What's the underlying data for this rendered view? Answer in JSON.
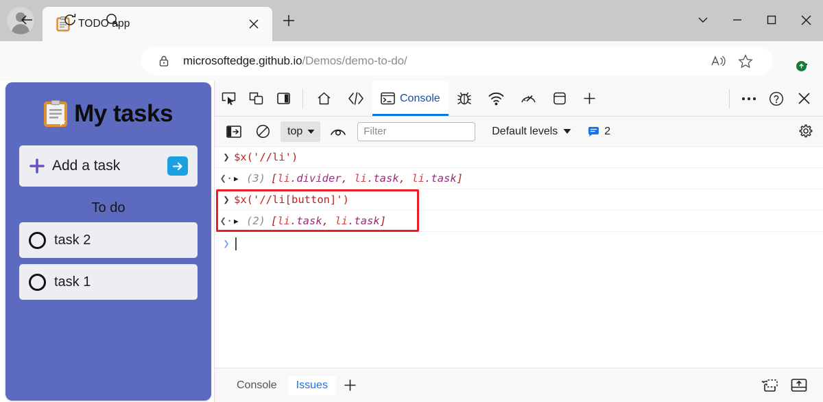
{
  "browser": {
    "tab": {
      "title": "TODO app",
      "favicon": "clipboard-icon",
      "close": "✕"
    },
    "new_tab_label": "+",
    "window_controls": {
      "more": "⌄",
      "minimize": "—",
      "maximize": "▢",
      "close": "✕"
    },
    "nav": {
      "back": "←",
      "reload": "⟳",
      "search": "⌕"
    },
    "address": {
      "lock": "lock-icon",
      "domain": "microsoftedge.github.io",
      "path": "/Demos/demo-to-do/"
    },
    "address_actions": {
      "read_aloud": "A",
      "favorite": "☆"
    },
    "settings_more": "…"
  },
  "todo": {
    "title": "My tasks",
    "favicon": "clipboard-icon",
    "add_task": {
      "plus": "✚",
      "label": "Add a task",
      "submit": "➜"
    },
    "section_label": "To do",
    "tasks": [
      {
        "label": "task 2",
        "done": false
      },
      {
        "label": "task 1",
        "done": false
      }
    ]
  },
  "devtools": {
    "toolbar_left_icons": [
      "inspect-element-icon",
      "device-emulation-icon",
      "toggle-sidebar-icon"
    ],
    "tabs": [
      {
        "label": "",
        "icon": "home-icon",
        "active": false
      },
      {
        "label": "",
        "icon": "elements-icon",
        "active": false
      },
      {
        "label": "Console",
        "icon": "console-icon",
        "active": true
      },
      {
        "label": "",
        "icon": "debugger-icon",
        "active": false
      },
      {
        "label": "",
        "icon": "network-icon",
        "active": false
      },
      {
        "label": "",
        "icon": "performance-icon",
        "active": false
      },
      {
        "label": "",
        "icon": "application-icon",
        "active": false
      },
      {
        "label": "",
        "icon": "add-tool-icon",
        "active": false
      }
    ],
    "toolbar_right": {
      "more": "…",
      "help": "?",
      "close": "✕"
    },
    "filterbar": {
      "sidebar_toggle": "console-sidebar-icon",
      "clear": "clear-console-icon",
      "context": "top",
      "context_caret": "▼",
      "eye": "live-expression-icon",
      "filter_placeholder": "Filter",
      "filter_value": "",
      "levels_label": "Default levels",
      "levels_caret": "▼",
      "message_count": "2",
      "message_icon": "info-bubble-icon",
      "settings": "gear-icon"
    },
    "console": {
      "entries": [
        {
          "type": "input",
          "gutter": "❯",
          "code": "$x('//li')",
          "highlighted": false
        },
        {
          "type": "output",
          "gutter": "❮·",
          "disclosure": "▶",
          "count": "(3)",
          "open_bracket": "[",
          "items": [
            {
              "tag": "li",
              "cls": ".divider"
            },
            {
              "tag": "li",
              "cls": ".task"
            },
            {
              "tag": "li",
              "cls": ".task"
            }
          ],
          "close_bracket": "]",
          "highlighted": false
        },
        {
          "type": "input",
          "gutter": "❯",
          "code": "$x('//li[button]')",
          "highlighted": true
        },
        {
          "type": "output",
          "gutter": "❮·",
          "disclosure": "▶",
          "count": "(2)",
          "open_bracket": "[",
          "items": [
            {
              "tag": "li",
              "cls": ".task"
            },
            {
              "tag": "li",
              "cls": ".task"
            }
          ],
          "close_bracket": "]",
          "highlighted": true
        }
      ],
      "prompt_caret": "❯",
      "prompt_value": ""
    },
    "drawer": {
      "tabs": [
        {
          "label": "Console",
          "active": false
        },
        {
          "label": "Issues",
          "active": true
        }
      ],
      "add": "+",
      "right_icons": [
        "restore-drawer-icon",
        "dock-to-bottom-icon"
      ]
    }
  },
  "colors": {
    "accent_blue": "#0b77e3",
    "todo_purple": "#5c6bc0",
    "card_gray": "#eceef2",
    "highlight_red": "#ec1c24",
    "submit_blue": "#1ba1e2",
    "plus_purple": "#6c4fc7",
    "link_blue": "#1a73e8",
    "update_green": "#107c41"
  }
}
